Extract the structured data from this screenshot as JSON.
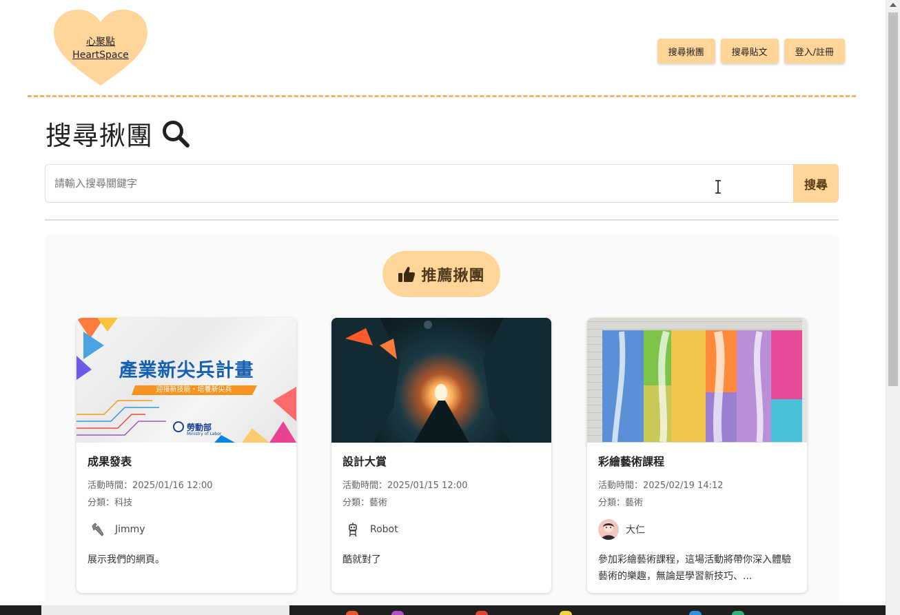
{
  "logo": {
    "line1": "心聚點",
    "line2": "HeartSpace"
  },
  "nav": {
    "items": [
      {
        "label": "搜尋揪團"
      },
      {
        "label": "搜尋貼文"
      },
      {
        "label": "登入/註冊"
      }
    ]
  },
  "page": {
    "title": "搜尋揪團"
  },
  "search": {
    "placeholder": "請輸入搜尋關鍵字",
    "value": "",
    "button": "搜尋"
  },
  "recommend": {
    "label": "推薦揪團"
  },
  "cards": [
    {
      "image_alt": "產業新尖兵計畫",
      "image_title": "產業新尖兵計畫",
      "image_subtitle": "迎接新技能・培養新尖兵",
      "image_org": "勞動部",
      "image_org_en": "Ministry of Labor",
      "title": "成果發表",
      "time": "活動時間：2025/01/16 12:00",
      "category": "分類：科技",
      "author": "Jimmy",
      "description": "展示我們的網頁。"
    },
    {
      "image_alt": "sci-fi corridor",
      "title": "設計大賞",
      "time": "活動時間：2025/01/15 12:00",
      "category": "分類：藝術",
      "author": "Robot",
      "description": "酷就對了"
    },
    {
      "image_alt": "colorful mural",
      "title": "彩繪藝術課程",
      "time": "活動時間：2025/02/19 14:12",
      "category": "分類：藝術",
      "author": "大仁",
      "description": "參加彩繪藝術課程，這場活動將帶你深入體驗藝術的樂趣，無論是學習新技巧、..."
    }
  ],
  "colors": {
    "accent": "#ffd59a",
    "dashed": "#f7b266",
    "logo_heart": "#ffd59a"
  }
}
